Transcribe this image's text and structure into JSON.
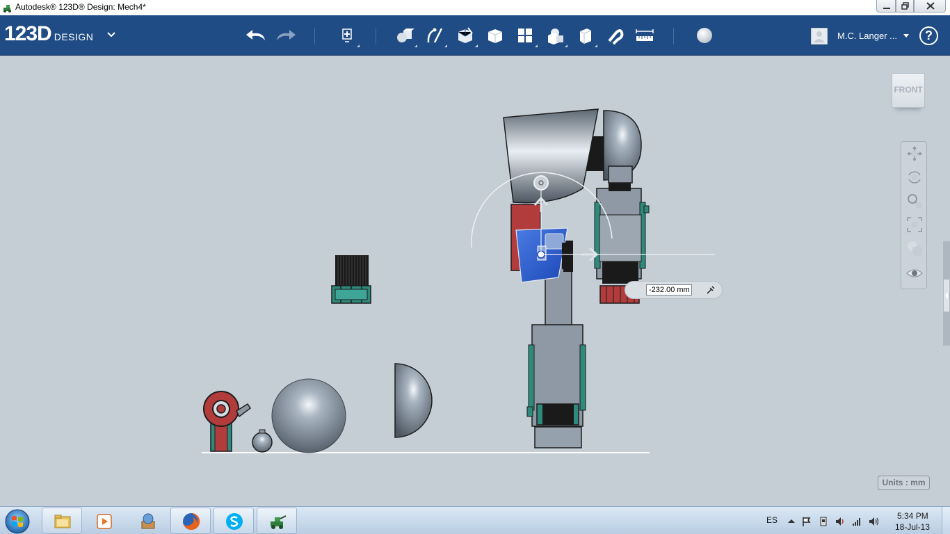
{
  "window": {
    "title": "Autodesk® 123D® Design: Mech4*"
  },
  "toolbar": {
    "logo_main": "123D",
    "logo_sub": "DESIGN",
    "user_name": "M.C. Langer ...",
    "help_label": "?"
  },
  "viewport": {
    "viewcube_label": "FRONT",
    "dimension_value": "-232.00 mm",
    "units_label": "Units : mm"
  },
  "taskbar": {
    "language": "ES",
    "time": "5:34 PM",
    "date": "18-Jul-13"
  },
  "colors": {
    "toolbar_bg": "#1f4c84",
    "viewport_bg": "#c5cdd5",
    "selection_blue": "#2a5ac8",
    "part_red": "#b23b3b",
    "part_teal": "#2e8a7c"
  }
}
